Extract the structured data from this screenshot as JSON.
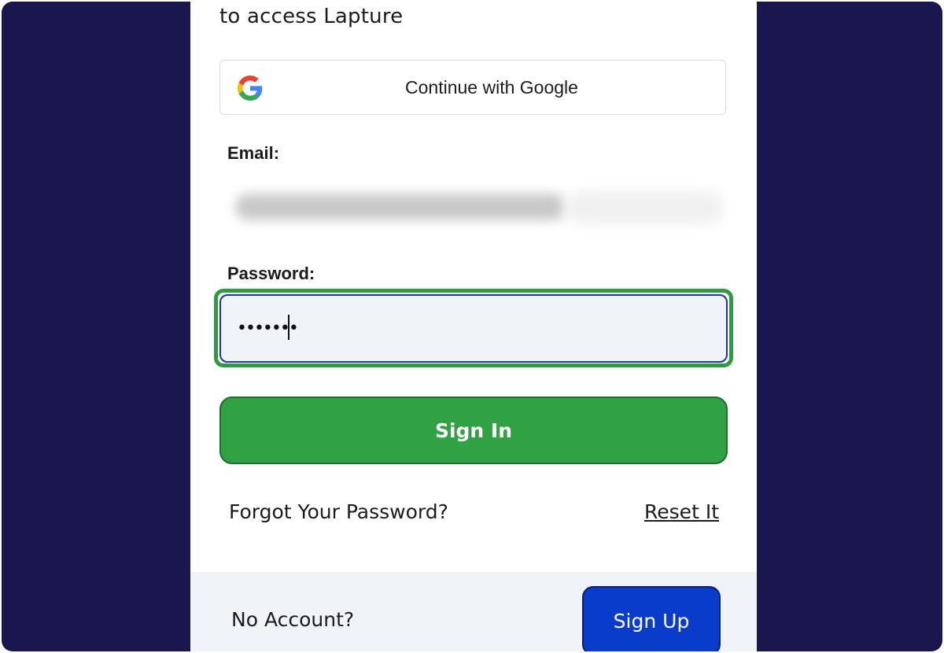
{
  "login": {
    "subtitle": "to access Lapture",
    "google_button_label": "Continue with Google",
    "email_label": "Email:",
    "password_label": "Password:",
    "password_value": "•••••••",
    "signin_label": "Sign In",
    "forgot_text": "Forgot Your Password?",
    "reset_link": "Reset It",
    "no_account_text": "No Account?",
    "signup_label": "Sign Up"
  },
  "colors": {
    "background": "#1a174e",
    "signin_green": "#31a243",
    "highlight_green": "#2e9c3e",
    "signup_blue": "#0a3ccb",
    "field_focus_border": "#1a33b8"
  },
  "icons": {
    "google": "google-g-icon"
  }
}
